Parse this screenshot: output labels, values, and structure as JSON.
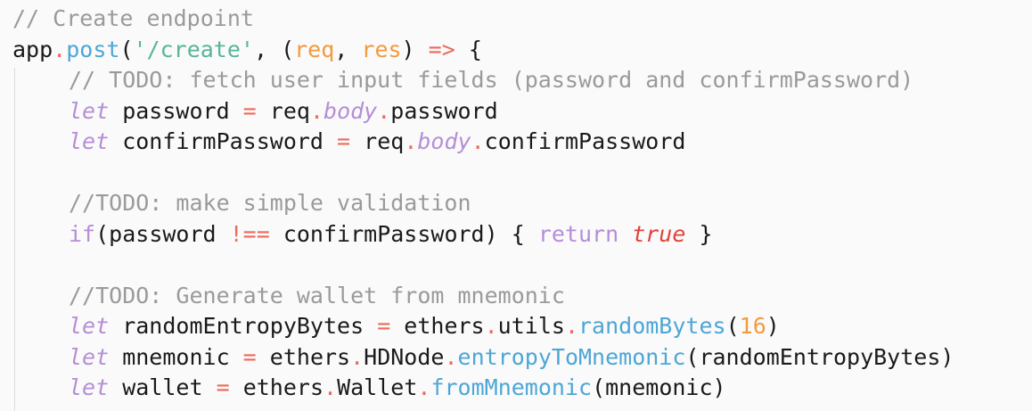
{
  "editor": {
    "lines": [
      {
        "indent": 0,
        "tokens": [
          {
            "t": "// Create endpoint",
            "k": "comment"
          }
        ]
      },
      {
        "indent": 0,
        "tokens": [
          {
            "t": "app",
            "k": "punct"
          },
          {
            "t": ".",
            "k": "op"
          },
          {
            "t": "post",
            "k": "fn"
          },
          {
            "t": "(",
            "k": "punct"
          },
          {
            "t": "'/create'",
            "k": "str"
          },
          {
            "t": ", (",
            "k": "punct"
          },
          {
            "t": "req",
            "k": "param"
          },
          {
            "t": ", ",
            "k": "punct"
          },
          {
            "t": "res",
            "k": "param"
          },
          {
            "t": ") ",
            "k": "punct"
          },
          {
            "t": "=>",
            "k": "op"
          },
          {
            "t": " {",
            "k": "punct"
          }
        ]
      },
      {
        "indent": 1,
        "tokens": [
          {
            "t": "// TODO: fetch user input fields (password and confirmPassword)",
            "k": "comment"
          }
        ]
      },
      {
        "indent": 1,
        "tokens": [
          {
            "t": "let",
            "k": "kw"
          },
          {
            "t": " password ",
            "k": "punct"
          },
          {
            "t": "=",
            "k": "op"
          },
          {
            "t": " req",
            "k": "punct"
          },
          {
            "t": ".",
            "k": "op"
          },
          {
            "t": "body",
            "k": "propital"
          },
          {
            "t": ".",
            "k": "op"
          },
          {
            "t": "password",
            "k": "punct"
          }
        ]
      },
      {
        "indent": 1,
        "tokens": [
          {
            "t": "let",
            "k": "kw"
          },
          {
            "t": " confirmPassword ",
            "k": "punct"
          },
          {
            "t": "=",
            "k": "op"
          },
          {
            "t": " req",
            "k": "punct"
          },
          {
            "t": ".",
            "k": "op"
          },
          {
            "t": "body",
            "k": "propital"
          },
          {
            "t": ".",
            "k": "op"
          },
          {
            "t": "confirmPassword",
            "k": "punct"
          }
        ]
      },
      {
        "indent": 1,
        "tokens": []
      },
      {
        "indent": 1,
        "tokens": [
          {
            "t": "//TODO: make simple validation",
            "k": "comment"
          }
        ]
      },
      {
        "indent": 1,
        "tokens": [
          {
            "t": "if",
            "k": "kw2"
          },
          {
            "t": "(password ",
            "k": "punct"
          },
          {
            "t": "!==",
            "k": "op"
          },
          {
            "t": " confirmPassword) { ",
            "k": "punct"
          },
          {
            "t": "return",
            "k": "kw2"
          },
          {
            "t": " ",
            "k": "punct"
          },
          {
            "t": "true",
            "k": "bool"
          },
          {
            "t": " }",
            "k": "punct"
          }
        ]
      },
      {
        "indent": 1,
        "tokens": []
      },
      {
        "indent": 1,
        "tokens": [
          {
            "t": "//TODO: Generate wallet from mnemonic",
            "k": "comment"
          }
        ]
      },
      {
        "indent": 1,
        "tokens": [
          {
            "t": "let",
            "k": "kw"
          },
          {
            "t": " randomEntropyBytes ",
            "k": "punct"
          },
          {
            "t": "=",
            "k": "op"
          },
          {
            "t": " ethers",
            "k": "punct"
          },
          {
            "t": ".",
            "k": "op"
          },
          {
            "t": "utils",
            "k": "punct"
          },
          {
            "t": ".",
            "k": "op"
          },
          {
            "t": "randomBytes",
            "k": "fn"
          },
          {
            "t": "(",
            "k": "punct"
          },
          {
            "t": "16",
            "k": "num"
          },
          {
            "t": ")",
            "k": "punct"
          }
        ]
      },
      {
        "indent": 1,
        "tokens": [
          {
            "t": "let",
            "k": "kw"
          },
          {
            "t": " mnemonic ",
            "k": "punct"
          },
          {
            "t": "=",
            "k": "op"
          },
          {
            "t": " ethers",
            "k": "punct"
          },
          {
            "t": ".",
            "k": "op"
          },
          {
            "t": "HDNode",
            "k": "punct"
          },
          {
            "t": ".",
            "k": "op"
          },
          {
            "t": "entropyToMnemonic",
            "k": "fn"
          },
          {
            "t": "(randomEntropyBytes)",
            "k": "punct"
          }
        ]
      },
      {
        "indent": 1,
        "tokens": [
          {
            "t": "let",
            "k": "kw"
          },
          {
            "t": " wallet ",
            "k": "punct"
          },
          {
            "t": "=",
            "k": "op"
          },
          {
            "t": " ethers",
            "k": "punct"
          },
          {
            "t": ".",
            "k": "op"
          },
          {
            "t": "Wallet",
            "k": "punct"
          },
          {
            "t": ".",
            "k": "op"
          },
          {
            "t": "fromMnemonic",
            "k": "fn"
          },
          {
            "t": "(mnemonic)",
            "k": "punct"
          }
        ]
      }
    ]
  }
}
